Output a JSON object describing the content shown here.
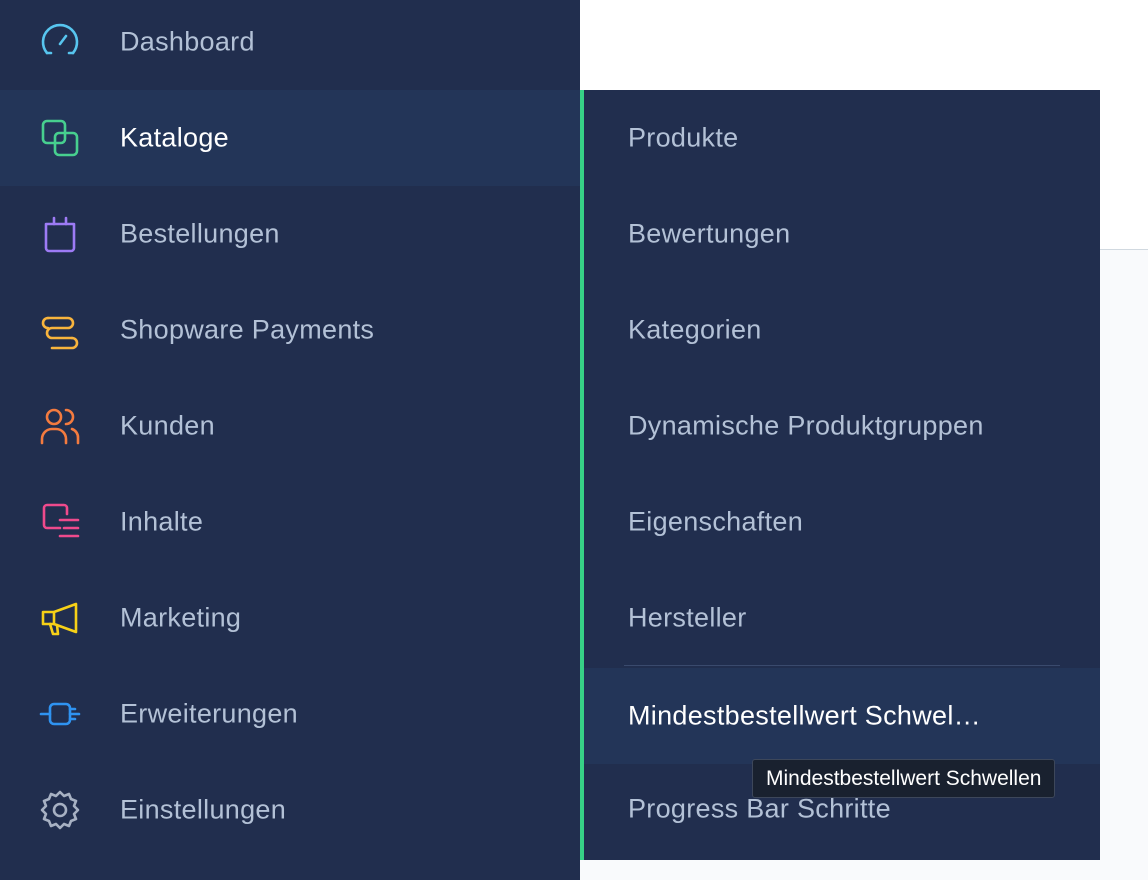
{
  "sidebar": {
    "items": [
      {
        "label": "Dashboard",
        "icon": "gauge-icon",
        "color": "#57c5ef"
      },
      {
        "label": "Kataloge",
        "icon": "copy-icon",
        "color": "#47cf8f",
        "active": true
      },
      {
        "label": "Bestellungen",
        "icon": "shopping-bag-icon",
        "color": "#9d7bf5"
      },
      {
        "label": "Shopware Payments",
        "icon": "payment-icon",
        "color": "#f8b43d"
      },
      {
        "label": "Kunden",
        "icon": "users-icon",
        "color": "#f47b3f"
      },
      {
        "label": "Inhalte",
        "icon": "content-icon",
        "color": "#ef4a8c"
      },
      {
        "label": "Marketing",
        "icon": "megaphone-icon",
        "color": "#f7d117"
      },
      {
        "label": "Erweiterungen",
        "icon": "plug-icon",
        "color": "#2f93f1"
      },
      {
        "label": "Einstellungen",
        "icon": "gear-icon",
        "color": "#a7b1c3"
      }
    ]
  },
  "submenu": {
    "items": [
      {
        "label": "Produkte"
      },
      {
        "label": "Bewertungen"
      },
      {
        "label": "Kategorien"
      },
      {
        "label": "Dynamische Produktgruppen"
      },
      {
        "label": "Eigenschaften"
      },
      {
        "label": "Hersteller"
      },
      {
        "label": "Mindestbestellwert Schwel…"
      },
      {
        "label": "Progress Bar Schritte"
      }
    ],
    "accent_color": "#37d186"
  },
  "tooltip": {
    "text": "Mindestbestellwert Schwellen"
  }
}
